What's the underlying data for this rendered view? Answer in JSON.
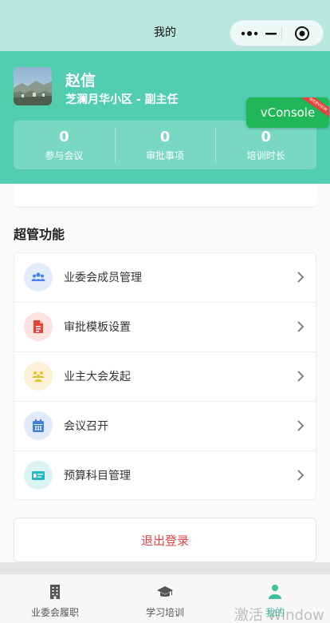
{
  "navbar": {
    "title": "我的"
  },
  "profile": {
    "name": "赵信",
    "role": "芝澜月华小区 - 副主任"
  },
  "stats": [
    {
      "value": "0",
      "label": "参与会议"
    },
    {
      "value": "0",
      "label": "审批事项"
    },
    {
      "value": "0",
      "label": "培训时长"
    }
  ],
  "vconsole": {
    "label": "vConsole",
    "ribbon": "WEBVIEW"
  },
  "section": {
    "title": "超管功能"
  },
  "menu": [
    {
      "label": "业委会成员管理",
      "icon": "users-icon",
      "color": "#4a86e8",
      "bg": "#e3ecfb"
    },
    {
      "label": "审批模板设置",
      "icon": "document-icon",
      "color": "#e0453a",
      "bg": "#fde2e0"
    },
    {
      "label": "业主大会发起",
      "icon": "group-icon",
      "color": "#e3c42b",
      "bg": "#fcf0d6"
    },
    {
      "label": "会议召开",
      "icon": "calendar-icon",
      "color": "#3f7fd8",
      "bg": "#e0eafa"
    },
    {
      "label": "预算科目管理",
      "icon": "card-icon",
      "color": "#20b6c4",
      "bg": "#d9f4f3"
    }
  ],
  "logout": {
    "label": "退出登录"
  },
  "tabs": [
    {
      "label": "业委会履职",
      "icon": "building-icon"
    },
    {
      "label": "学习培训",
      "icon": "graduation-cap-icon"
    },
    {
      "label": "我的",
      "icon": "person-icon",
      "active": true
    }
  ],
  "colors": {
    "accent": "#52cdb0",
    "danger": "#e04545",
    "active_tab": "#3fbf9f"
  },
  "watermark": "激活 Window"
}
